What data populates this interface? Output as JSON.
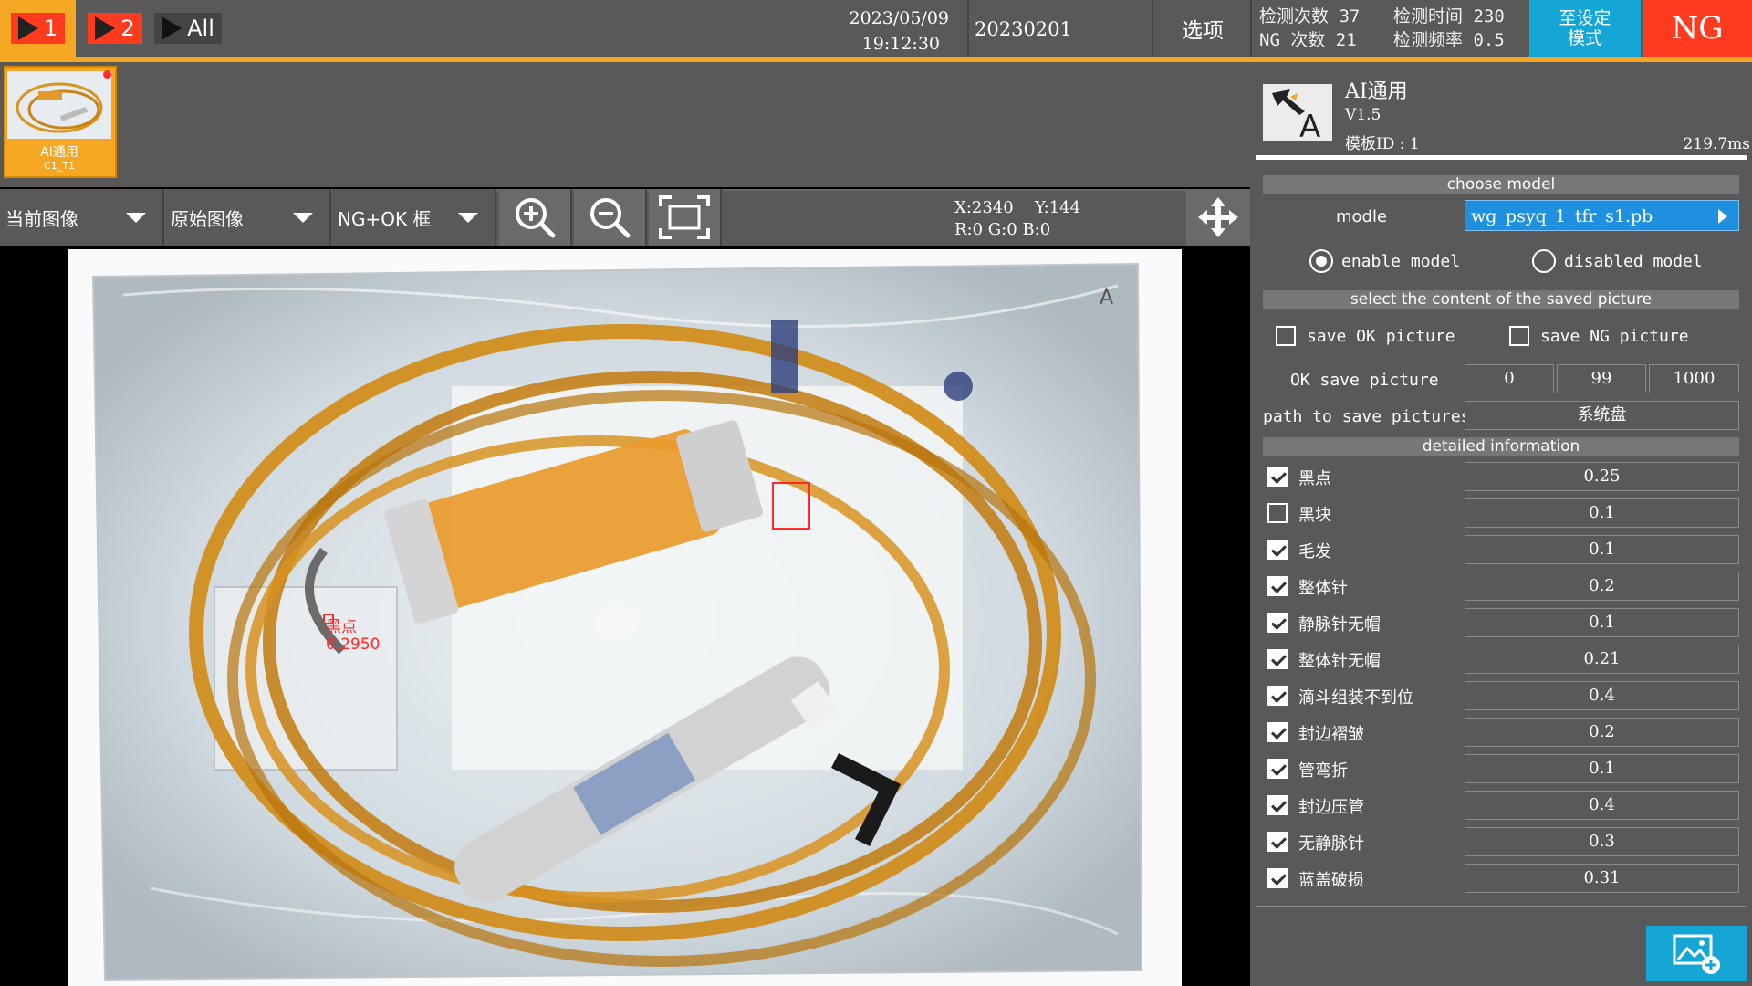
{
  "topbar": {
    "cam1": "1",
    "cam2": "2",
    "cam_all": "All",
    "date": "2023/05/09",
    "time": "19:12:30",
    "batch": "20230201",
    "options": "选项",
    "detect_count_label": "检测次数 37",
    "ng_count_label": "NG 次数  21",
    "detect_time_label": "检测时间 230",
    "detect_freq_label": "检测频率 0.5",
    "mode_button": "至设定模式",
    "result": "NG"
  },
  "thumbnail": {
    "label": "AI通用",
    "sublabel": "C1_T1"
  },
  "toolbar": {
    "dropdown1": "当前图像",
    "dropdown2": "原始图像",
    "dropdown3": "NG+OK 框",
    "coord_x": "X:2340",
    "coord_y": "Y:144",
    "rgb": "R:0 G:0 B:0"
  },
  "image": {
    "defect_label": "黑点",
    "defect_score": "0.2950"
  },
  "panel": {
    "title": "AI通用",
    "version": "V1.5",
    "template_id": "模板ID : 1",
    "elapsed": "219.7ms",
    "section_model": "choose model",
    "model_label": "modle",
    "model_value": "wg_psyq_1_tfr_s1.pb",
    "enable_model": "enable model",
    "disable_model": "disabled model",
    "section_save": "select the content of the saved picture",
    "save_ok": "save OK picture",
    "save_ng": "save NG picture",
    "ok_save_label": "OK save picture",
    "ok_save_values": [
      "0",
      "99",
      "1000"
    ],
    "path_label": "path to save pictures",
    "path_value": "系统盘",
    "section_detail": "detailed information",
    "details": [
      {
        "name": "黑点",
        "value": "0.25",
        "checked": true
      },
      {
        "name": "黑块",
        "value": "0.1",
        "checked": false
      },
      {
        "name": "毛发",
        "value": "0.1",
        "checked": true
      },
      {
        "name": "整体针",
        "value": "0.2",
        "checked": true
      },
      {
        "name": "静脉针无帽",
        "value": "0.1",
        "checked": true
      },
      {
        "name": "整体针无帽",
        "value": "0.21",
        "checked": true
      },
      {
        "name": "滴斗组装不到位",
        "value": "0.4",
        "checked": true
      },
      {
        "name": "封边褶皱",
        "value": "0.2",
        "checked": true
      },
      {
        "name": "管弯折",
        "value": "0.1",
        "checked": true
      },
      {
        "name": "封边压管",
        "value": "0.4",
        "checked": true
      },
      {
        "name": "无静脉针",
        "value": "0.3",
        "checked": true
      },
      {
        "name": "蓝盖破损",
        "value": "0.31",
        "checked": true
      }
    ]
  },
  "colors": {
    "accent": "#f5a623",
    "ng_red": "#ff3b1f",
    "mode_blue": "#16a6d6",
    "bar_gray": "#595959"
  }
}
